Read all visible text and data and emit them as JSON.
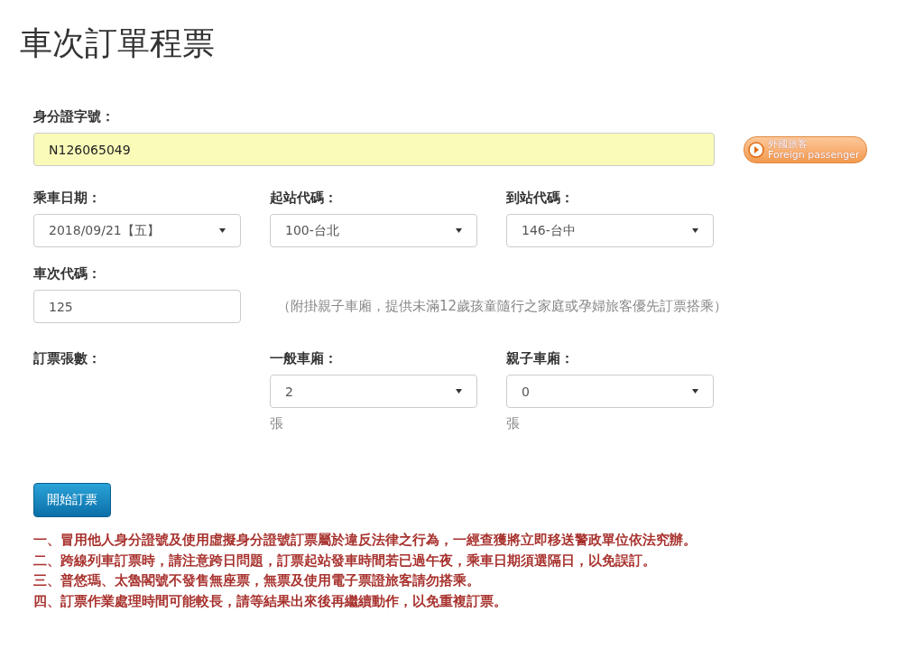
{
  "title": "車次訂單程票",
  "id_field": {
    "label": "身分證字號：",
    "value": "N126065049"
  },
  "foreign_button": {
    "line1": "外國旅客",
    "line2": "Foreign passenger"
  },
  "date": {
    "label": "乘車日期：",
    "value": "2018/09/21【五】"
  },
  "from_station": {
    "label": "起站代碼：",
    "value": "100-台北"
  },
  "to_station": {
    "label": "到站代碼：",
    "value": "146-台中"
  },
  "train_no": {
    "label": "車次代碼：",
    "value": "125",
    "note": "（附掛親子車廂，提供未滿12歲孩童隨行之家庭或孕婦旅客優先訂票搭乘）"
  },
  "ticket_count": {
    "label": "訂票張數：",
    "normal": {
      "label": "一般車廂：",
      "value": "2",
      "unit": "張"
    },
    "family": {
      "label": "親子車廂：",
      "value": "0",
      "unit": "張"
    }
  },
  "submit_button": "開始訂票",
  "notes": [
    "一、冒用他人身分證號及使用虛擬身分證號訂票屬於違反法律之行為，一經查獲將立即移送警政單位依法究辦。",
    "二、跨線列車訂票時，請注意跨日問題，訂票起站發車時間若已過午夜，乘車日期須選隔日，以免誤訂。",
    "三、普悠瑪、太魯閣號不發售無座票，無票及使用電子票證旅客請勿搭乘。",
    "四、訂票作業處理時間可能較長，請等結果出來後再繼續動作，以免重複訂票。"
  ]
}
